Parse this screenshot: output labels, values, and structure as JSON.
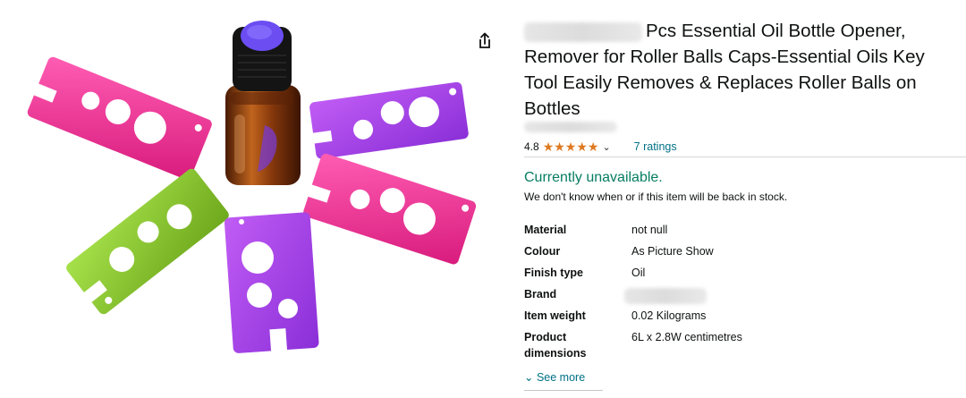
{
  "product": {
    "title": "Pcs Essential Oil Bottle Opener, Remover for Roller Balls Caps-Essential Oils Key Tool Easily Removes & Replaces Roller Balls on Bottles",
    "title_line1": "Pcs Essential Oil Bottle Opener,",
    "title_line2": "Remover for Roller Balls Caps-Essential Oils Key",
    "title_line3": "Tool Easily Removes & Replaces Roller Balls on",
    "title_line4": "Bottles"
  },
  "rating": {
    "value": "4.8",
    "stars": "★★★★★",
    "stars_count": 5,
    "caret": "⌄",
    "count_label": "7 ratings"
  },
  "availability": {
    "status": "Currently unavailable.",
    "message": "We don't know when or if this item will be back in stock."
  },
  "specs": [
    {
      "key": "Material",
      "value": "not null"
    },
    {
      "key": "Colour",
      "value": "As Picture Show"
    },
    {
      "key": "Finish type",
      "value": "Oil"
    },
    {
      "key": "Brand",
      "value": ""
    },
    {
      "key": "Item weight",
      "value": "0.02 Kilograms"
    },
    {
      "key": "Product",
      "key2": "dimensions",
      "value": "6L x 2.8W centimetres"
    }
  ],
  "see_more": {
    "chevron": "⌄",
    "label": "See more"
  },
  "icons": {
    "share": "share-icon",
    "star": "star-icon"
  },
  "colors": {
    "link": "#007185",
    "available_green": "#067d62",
    "star": "#de7921",
    "tool_pink": "#e8318f",
    "tool_purple": "#a23fe6",
    "tool_green": "#86c52a"
  }
}
